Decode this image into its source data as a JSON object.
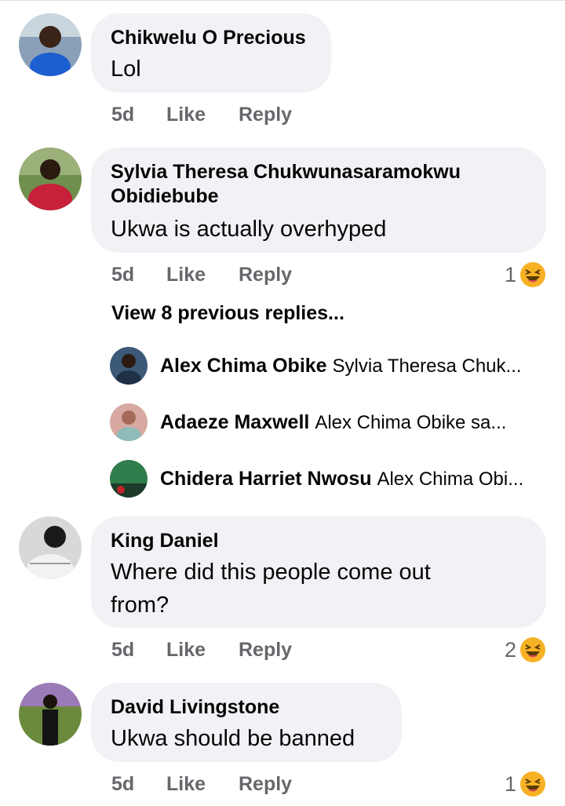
{
  "comments": [
    {
      "author": "Chikwelu O Precious",
      "text": "Lol",
      "time": "5d",
      "like": "Like",
      "reply": "Reply"
    },
    {
      "author_line1": "Sylvia Theresa Chukwunasaramokwu",
      "author_line2": "Obidiebube",
      "text": "Ukwa is actually overhyped",
      "time": "5d",
      "like": "Like",
      "reply": "Reply",
      "reaction_count": "1",
      "reaction_icon": "laughing-emoji-icon",
      "view_previous": "View 8 previous replies...",
      "replies": [
        {
          "name": "Alex Chima Obike",
          "preview": "Sylvia Theresa Chuk..."
        },
        {
          "name": "Adaeze Maxwell",
          "preview": "Alex Chima Obike sa..."
        },
        {
          "name": "Chidera Harriet Nwosu",
          "preview": "Alex Chima Obi..."
        }
      ]
    },
    {
      "author": "King Daniel",
      "text_line1": "Where did this people come out",
      "text_line2": "from?",
      "time": "5d",
      "like": "Like",
      "reply": "Reply",
      "reaction_count": "2",
      "reaction_icon": "laughing-emoji-icon"
    },
    {
      "author": "David Livingstone",
      "text": "Ukwa should be banned",
      "time": "5d",
      "like": "Like",
      "reply": "Reply",
      "reaction_count": "1",
      "reaction_icon": "laughing-emoji-icon"
    }
  ],
  "colors": {
    "bubble": "#f0f2f5",
    "meta": "#65676b",
    "text": "#050505",
    "emoji": "#f7b125"
  }
}
